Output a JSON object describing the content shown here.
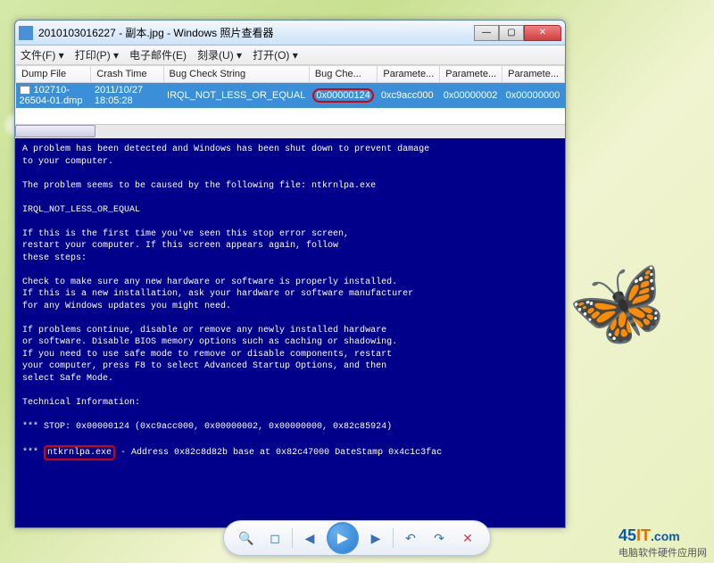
{
  "window": {
    "title": "2010103016227 - 副本.jpg - Windows 照片查看器"
  },
  "menu": {
    "file": "文件(F) ▾",
    "print": "打印(P) ▾",
    "email": "电子邮件(E)",
    "burn": "刻录(U) ▾",
    "open": "打开(O) ▾"
  },
  "table": {
    "headers": {
      "dump_file": "Dump File",
      "crash_time": "Crash Time",
      "bug_check_string": "Bug Check String",
      "bug_check": "Bug Che...",
      "param1": "Paramete...",
      "param2": "Paramete...",
      "param3": "Paramete..."
    },
    "row": {
      "dump_file": "102710-26504-01.dmp",
      "crash_time": "2011/10/27 18:05:28",
      "bug_check_string": "IRQL_NOT_LESS_OR_EQUAL",
      "bug_check": "0x00000124",
      "param1": "0xc9acc000",
      "param2": "0x00000002",
      "param3": "0x00000000"
    }
  },
  "bsod": {
    "l1": "A problem has been detected and Windows has been shut down to prevent damage",
    "l2": "to your computer.",
    "l3": "The problem seems to be caused by the following file: ntkrnlpa.exe",
    "l4": "IRQL_NOT_LESS_OR_EQUAL",
    "l5": "If this is the first time you've seen this stop error screen,",
    "l6": "restart your computer. If this screen appears again, follow",
    "l7": "these steps:",
    "l8": "Check to make sure any new hardware or software is properly installed.",
    "l9": "If this is a new installation, ask your hardware or software manufacturer",
    "l10": "for any Windows updates you might need.",
    "l11": "If problems continue, disable or remove any newly installed hardware",
    "l12": "or software. Disable BIOS memory options such as caching or shadowing.",
    "l13": "If you need to use safe mode to remove or disable components, restart",
    "l14": "your computer, press F8 to select Advanced Startup Options, and then",
    "l15": "select Safe Mode.",
    "l16": "Technical Information:",
    "l17a": "*** STOP: 0x00000124 (0xc9acc000, 0x00000002, 0x00000000, 0x82c85924)",
    "l18a": "*** ",
    "l18b": "ntkrnlpa.exe",
    "l18c": " - Address 0x82c8d82b base at 0x82c47000 DateStamp 0x4c1c3fac"
  },
  "watermark": {
    "domain_a": "45",
    "domain_b": "IT",
    "domain_c": ".com",
    "sub": "电脑软件硬件应用网"
  }
}
